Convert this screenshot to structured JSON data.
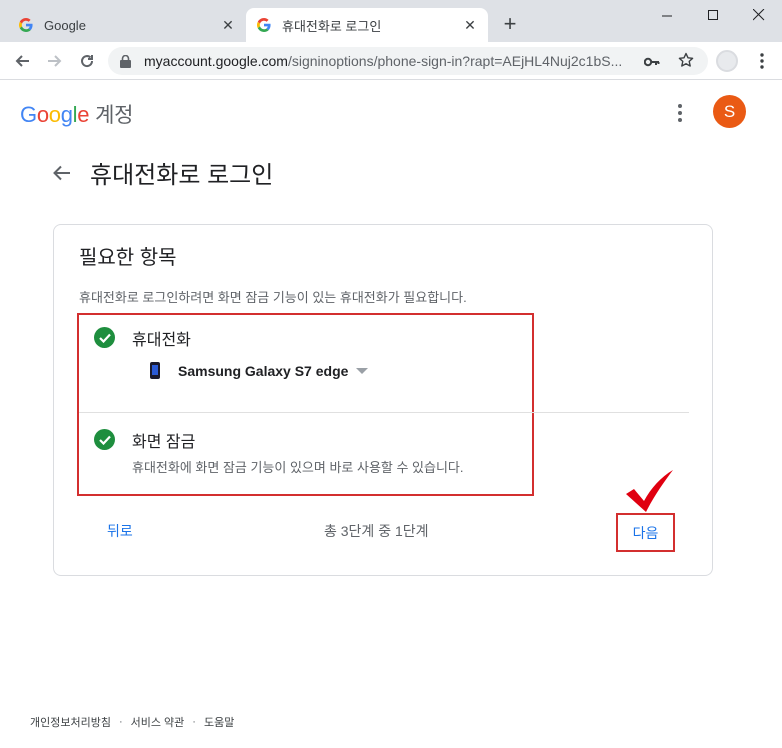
{
  "browser": {
    "tabs": [
      {
        "title": "Google",
        "active": false
      },
      {
        "title": "휴대전화로 로그인",
        "active": true
      }
    ],
    "url_host": "myaccount.google.com",
    "url_path": "/signinoptions/phone-sign-in?rapt=AEjHL4Nuj2c1bS..."
  },
  "header": {
    "logo_letters": [
      "G",
      "o",
      "o",
      "g",
      "l",
      "e"
    ],
    "logo_colors": [
      "#4285F4",
      "#EA4335",
      "#FBBC05",
      "#4285F4",
      "#34A853",
      "#EA4335"
    ],
    "account_label": "계정",
    "avatar_initial": "S",
    "avatar_color": "#ea5a14"
  },
  "page": {
    "title": "휴대전화로 로그인"
  },
  "card": {
    "title": "필요한 항목",
    "description": "휴대전화로 로그인하려면 화면 잠금 기능이 있는 휴대전화가 필요합니다.",
    "items": [
      {
        "title": "휴대전화",
        "device": "Samsung Galaxy S7 edge"
      },
      {
        "title": "화면 잠금",
        "subtitle": "휴대전화에 화면 잠금 기능이 있으며 바로 사용할 수 있습니다."
      }
    ],
    "back_label": "뒤로",
    "step_text": "총 3단계 중 1단계",
    "next_label": "다음"
  },
  "footer": {
    "links": [
      "개인정보처리방침",
      "서비스 약관",
      "도움말"
    ],
    "separator": "·"
  },
  "colors": {
    "accent": "#1a73e8",
    "check_green": "#1e8e3e",
    "highlight_red": "#d32f2f"
  }
}
